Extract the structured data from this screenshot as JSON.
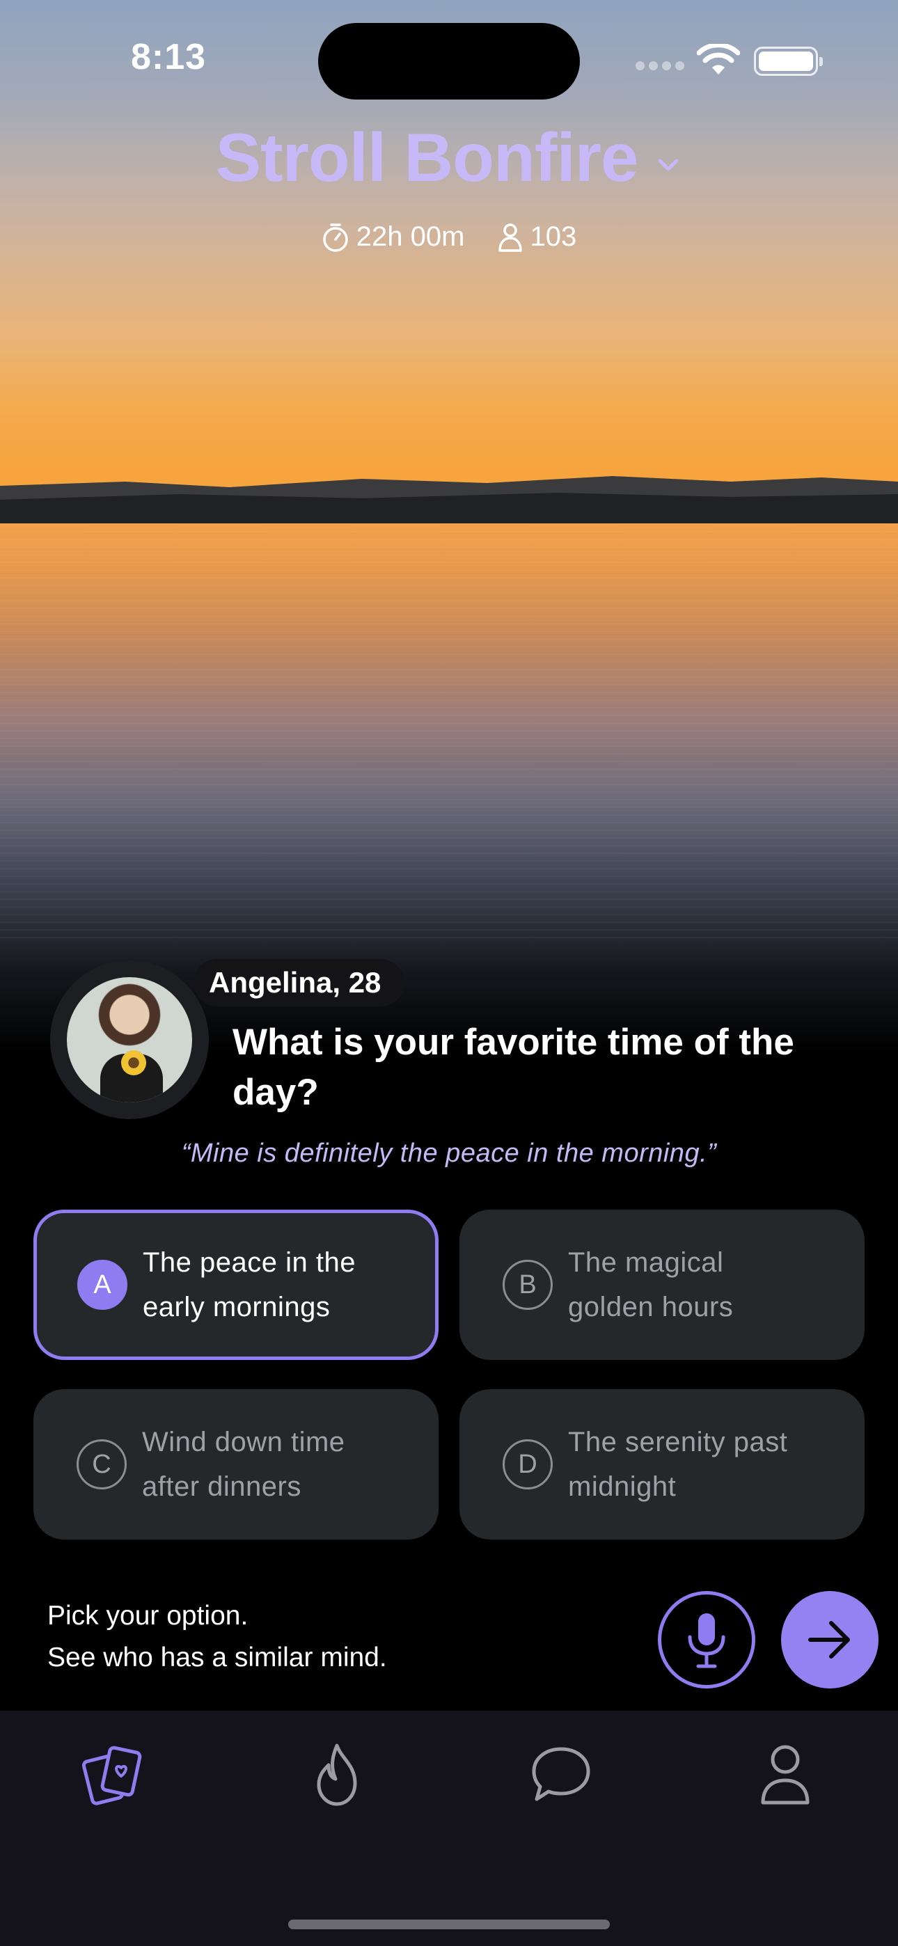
{
  "status_bar": {
    "time": "8:13"
  },
  "header": {
    "title": "Stroll Bonfire",
    "timer": "22h 00m",
    "participants": "103"
  },
  "prompt": {
    "user_name": "Angelina, 28",
    "question": "What is your favorite time of the day?",
    "quote": "“Mine is definitely the peace in the morning.”"
  },
  "options": [
    {
      "letter": "A",
      "text": "The peace in the\nearly mornings",
      "selected": true
    },
    {
      "letter": "B",
      "text": "The magical\ngolden hours",
      "selected": false
    },
    {
      "letter": "C",
      "text": "Wind down time\nafter dinners",
      "selected": false
    },
    {
      "letter": "D",
      "text": "The serenity past\nmidnight",
      "selected": false
    }
  ],
  "footer": {
    "hint_line1": "Pick your option.",
    "hint_line2": "See who has a similar mind."
  },
  "tabs": [
    {
      "icon": "cards-icon",
      "active": true
    },
    {
      "icon": "flame-icon",
      "active": false
    },
    {
      "icon": "chat-icon",
      "active": false
    },
    {
      "icon": "profile-icon",
      "active": false
    }
  ],
  "colors": {
    "accent": "#8f7cf0",
    "title": "#c7b8f7",
    "option_bg": "#24282b",
    "tabbar_bg": "#14121a"
  }
}
